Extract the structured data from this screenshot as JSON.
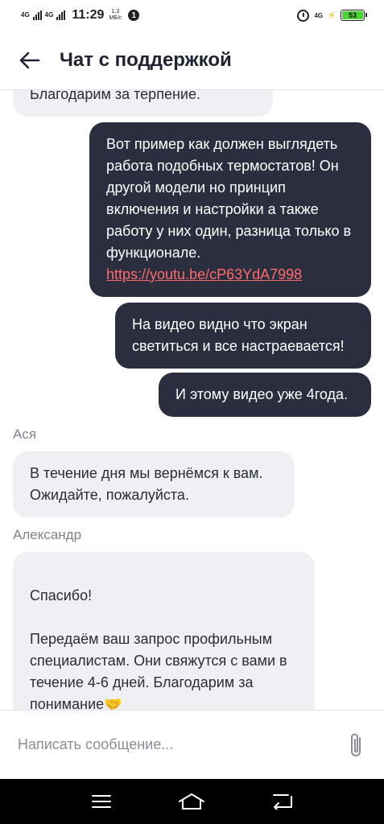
{
  "status_bar": {
    "net_left_1": "4G",
    "net_left_2": "4G",
    "time": "11:29",
    "speed_value": "1,3",
    "speed_unit": "МБ/с",
    "notification_count": "1",
    "net_right": "4G",
    "battery": "53"
  },
  "header": {
    "title": "Чат с поддержкой",
    "back_icon": "arrow-left-icon"
  },
  "messages": [
    {
      "side": "in",
      "text": "Благодарим за терпение."
    },
    {
      "side": "out",
      "text": "Вот пример как должен выглядеть работа подобных термостатов! Он другой модели но принцип включения и настройки а также работу у них один, разница только в функционале.",
      "link": "https://youtu.be/cP63YdA7998"
    },
    {
      "side": "out",
      "text": "На видео видно что экран светиться и все настраевается!"
    },
    {
      "side": "out",
      "text": "И этому видео уже 4года."
    },
    {
      "side": "in",
      "sender": "Ася",
      "text": "В течение дня мы вернёмся к вам. Ожидайте, пожалуйста."
    },
    {
      "side": "in",
      "sender": "Александр",
      "text": "Спасибо!\n\nПередаём ваш запрос профильным специалистам. Они свяжутся с вами в течение 4-6 дней. Благодарим за понимание🤝"
    }
  ],
  "composer": {
    "placeholder": "Написать сообщение...",
    "attach_icon": "paperclip-icon"
  },
  "nav_bar": {
    "icons": [
      "menu-icon",
      "home-icon",
      "back-icon"
    ]
  },
  "colors": {
    "outgoing_bubble": "#2b2e3f",
    "incoming_bubble": "#eef0f4",
    "link": "#ff6a6a",
    "battery": "#4cd137"
  }
}
